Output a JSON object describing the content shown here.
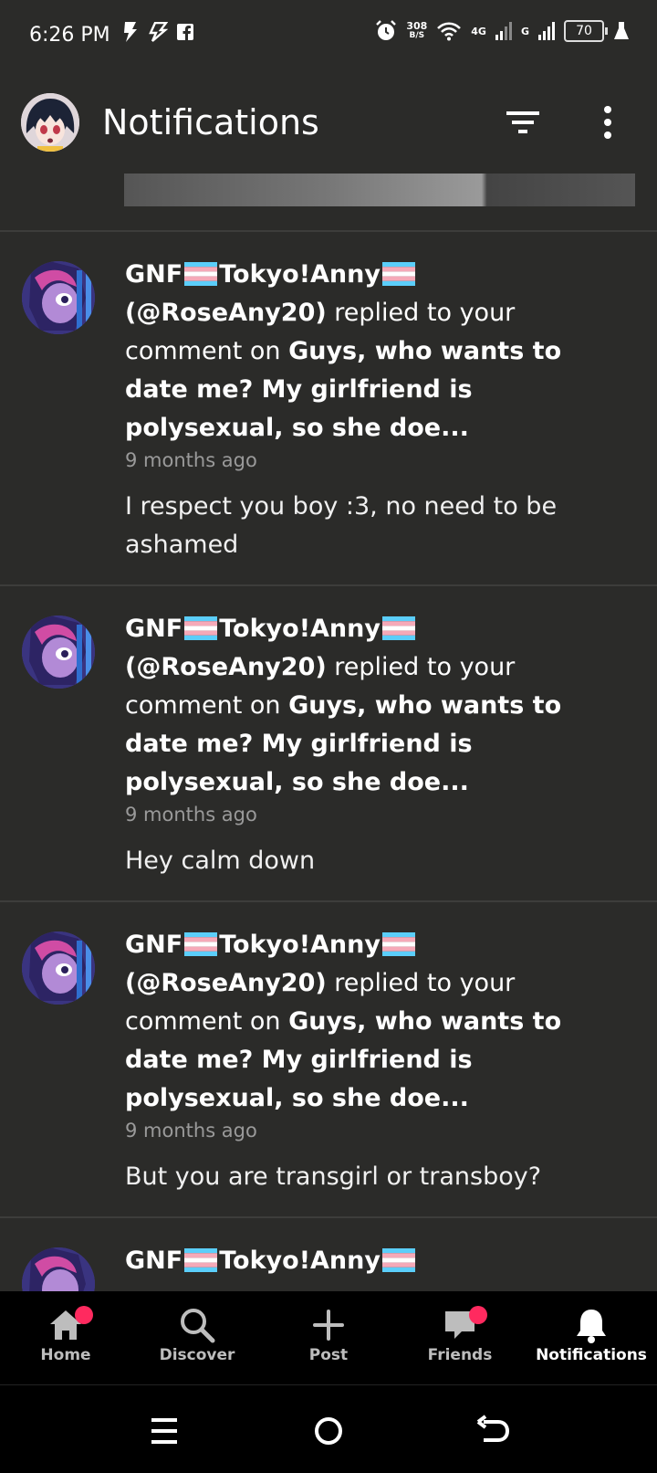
{
  "status_bar": {
    "time": "6:26 PM",
    "net_speed_value": "308",
    "net_speed_unit": "B/S",
    "network_4g": "4G",
    "network_g": "G",
    "battery": "70"
  },
  "app_bar": {
    "title": "Notifications",
    "icons": [
      "profile-avatar",
      "filter-icon",
      "more-vert-icon"
    ]
  },
  "notifications": [
    {
      "user": "GNF",
      "user_suffix": "Tokyo!Anny",
      "handle": "(@RoseAny20)",
      "action": " replied to your comment on ",
      "post": "Guys, who wants to date me? My girlfriend is polysexual, so she doe...",
      "time": "9 months ago",
      "message": "I respect you boy :3,  no need to be ashamed"
    },
    {
      "user": "GNF",
      "user_suffix": "Tokyo!Anny",
      "handle": "(@RoseAny20)",
      "action": " replied to your comment on ",
      "post": "Guys, who wants to date me? My girlfriend is polysexual, so she doe...",
      "time": "9 months ago",
      "message": "Hey calm down"
    },
    {
      "user": "GNF",
      "user_suffix": "Tokyo!Anny",
      "handle": "(@RoseAny20)",
      "action": " replied to your comment on ",
      "post": "Guys, who wants to date me? My girlfriend is polysexual, so she doe...",
      "time": "9 months ago",
      "message": "But you are transgirl or transboy?"
    },
    {
      "user": "GNF",
      "user_suffix": "Tokyo!Anny",
      "handle": "",
      "action": "",
      "post": "",
      "time": "",
      "message": ""
    }
  ],
  "bottom_nav": {
    "home": "Home",
    "discover": "Discover",
    "post": "Post",
    "friends": "Friends",
    "notifications": "Notifications"
  },
  "colors": {
    "background": "#2b2b29",
    "divider": "#3d3d3b",
    "badge": "#ff2a5f",
    "nav_background": "#000000"
  }
}
